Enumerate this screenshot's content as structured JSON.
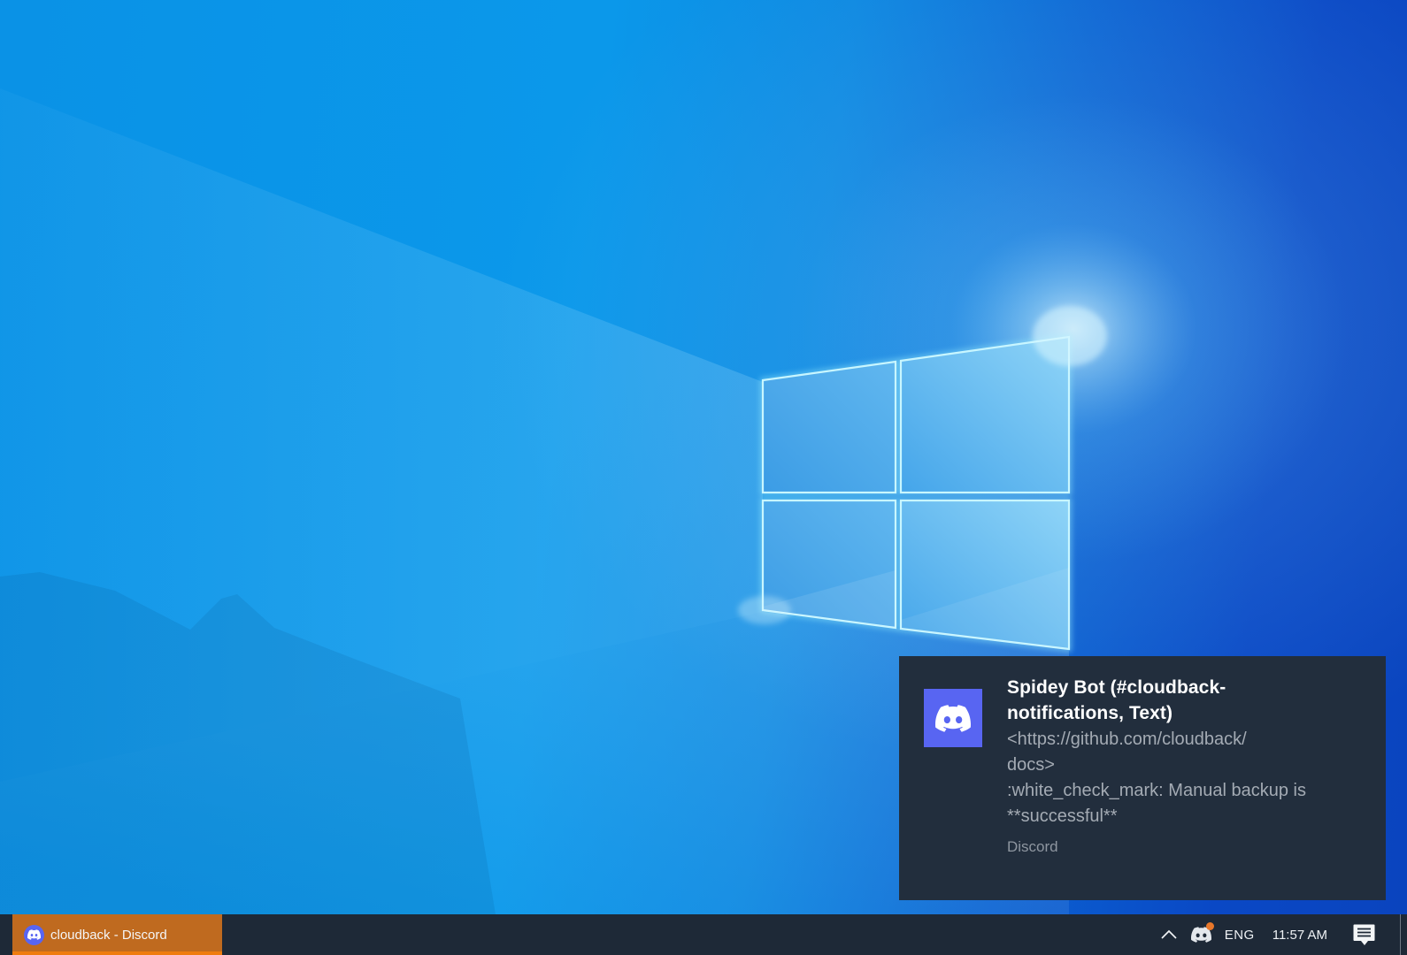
{
  "colors": {
    "discord_blurple": "#5865F2",
    "toast_background": "#222e3d",
    "taskbar_background": "#1e2937",
    "attention_button_orange": "#bf6a1f",
    "attention_underline_orange": "#ef7c0e",
    "tray_badge_orange": "#e8772a",
    "wallpaper_azure": "#0b98ea",
    "wallpaper_royal_blue": "#0a45c2"
  },
  "toast": {
    "title": "Spidey Bot (#cloudback-\nnotifications, Text)",
    "body": "<https://github.com/cloudback/\ndocs>\n:white_check_mark: Manual backup is\n**successful**",
    "source": "Discord"
  },
  "taskbar": {
    "app_button": {
      "label": "cloudback - Discord",
      "attention": true
    },
    "tray": {
      "language": "ENG",
      "time": "11:57 AM"
    }
  }
}
